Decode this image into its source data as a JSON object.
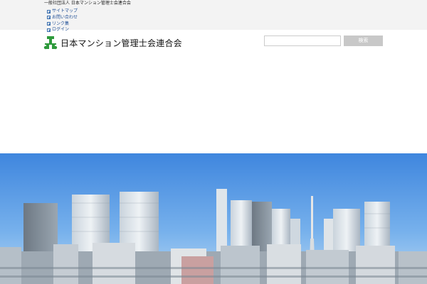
{
  "header": {
    "tagline": "一般社団法人 日本マンション管理士会連合会",
    "utility_links": [
      {
        "label": "サイトマップ"
      },
      {
        "label": "お問い合わせ"
      },
      {
        "label": "リンク集"
      },
      {
        "label": "ログイン"
      }
    ],
    "logo_text": "日本マンション管理士会連合会",
    "logo_color": "#2e9a3c"
  },
  "search": {
    "value": "",
    "placeholder": "",
    "button_label": "検索"
  },
  "hero": {
    "image": "tokyo-skyline-photo",
    "sky_color": "#4a8ee0"
  }
}
